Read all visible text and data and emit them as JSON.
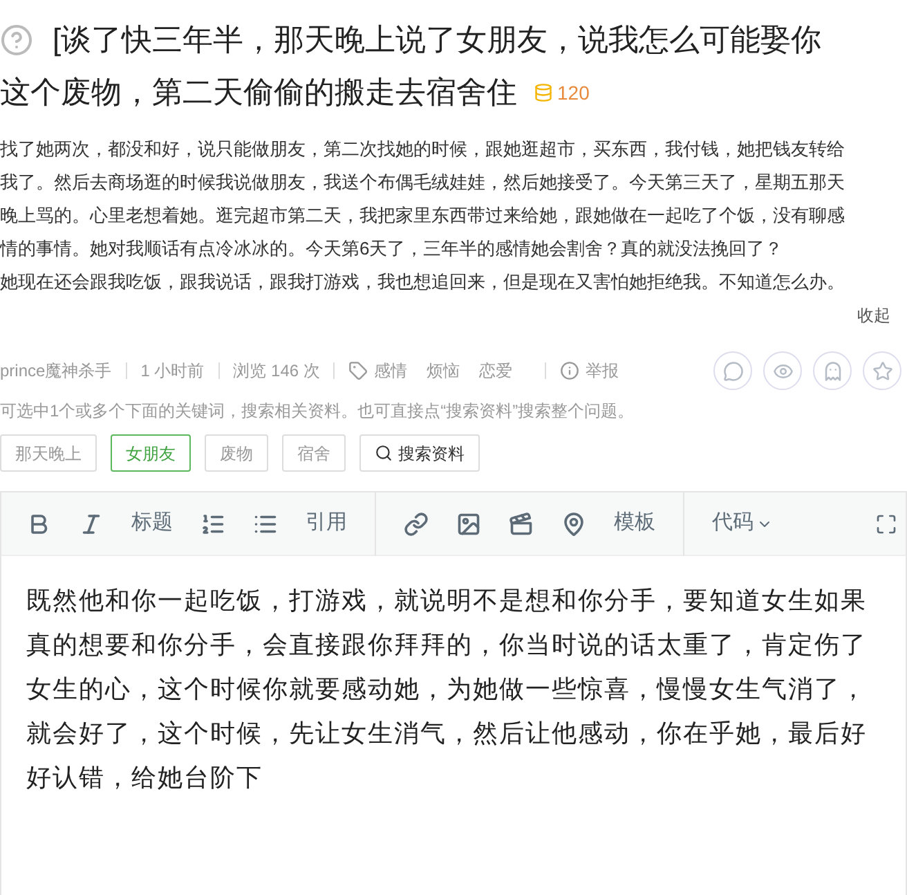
{
  "question": {
    "title_lines": [
      "[谈了快三年半，那天晚上说了女朋友，说我怎么可能娶你",
      "这个废物，第二天偷偷的搬走去宿舍住"
    ],
    "reward": "120"
  },
  "description": {
    "lines": [
      "找了她两次，都没和好，说只能做朋友，第二次找她的时候，跟她逛超市，买东西，我付钱，她把钱友转给",
      "我了。然后去商场逛的时候我说做朋友，我送个布偶毛绒娃娃，然后她接受了。今天第三天了，星期五那天",
      "晚上骂的。心里老想着她。逛完超市第二天，我把家里东西带过来给她，跟她做在一起吃了个饭，没有聊感",
      "情的事情。她对我顺话有点冷冰冰的。今天第6天了，三年半的感情她会割舍？真的就没法挽回了？",
      "她现在还会跟我吃饭，跟我说话，跟我打游戏，我也想追回来，但是现在又害怕她拒绝我。不知道怎么办。"
    ],
    "collapse": "收起"
  },
  "meta": {
    "author": "prince魔神杀手",
    "time": "1 小时前",
    "views": "浏览 146 次",
    "tags": [
      "感情",
      "烦恼",
      "恋爱"
    ],
    "report": "举报"
  },
  "share": [
    {
      "kind": "wechat"
    },
    {
      "kind": "weibo"
    },
    {
      "kind": "qq"
    },
    {
      "kind": "qzone"
    }
  ],
  "keyword_hint": "可选中1个或多个下面的关键词，搜索相关资料。也可直接点“搜索资料”搜索整个问题。",
  "keywords": [
    {
      "label": "那天晚上",
      "selected": false
    },
    {
      "label": "女朋友",
      "selected": true
    },
    {
      "label": "废物",
      "selected": false
    },
    {
      "label": "宿舍",
      "selected": false
    }
  ],
  "search_button": "搜索资料",
  "toolbar": [
    {
      "kind": "bold"
    },
    {
      "kind": "italic"
    },
    {
      "kind": "text",
      "label": "标题"
    },
    {
      "kind": "ordered"
    },
    {
      "kind": "bullets"
    },
    {
      "kind": "text",
      "label": "引用"
    },
    {
      "kind": "divider"
    },
    {
      "kind": "link"
    },
    {
      "kind": "image"
    },
    {
      "kind": "video"
    },
    {
      "kind": "location"
    },
    {
      "kind": "text",
      "label": "模板"
    },
    {
      "kind": "divider"
    },
    {
      "kind": "dropdown",
      "label": "代码"
    }
  ],
  "answer": "既然他和你一起吃饭，打游戏，就说明不是想和你分手，要知道女生如果真的想要和你分手，会直接跟你拜拜的，你当时说的话太重了，肯定伤了女生的心，这个时候你就要感动她，为她做一些惊喜，慢慢女生气消了，就会好了，这个时候，先让女生消气，然后让他感动，你在乎她，最后好好认错，给她台阶下"
}
